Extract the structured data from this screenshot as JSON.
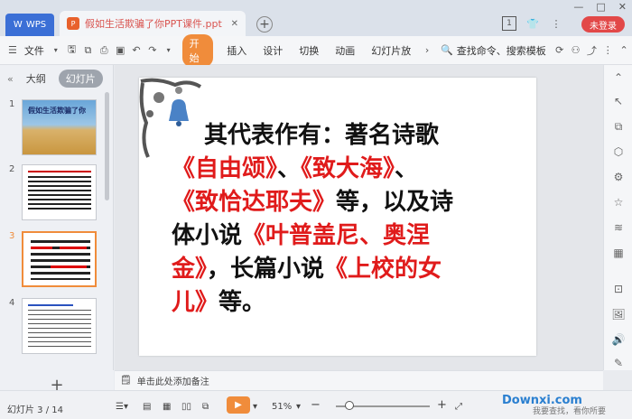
{
  "app": {
    "name": "WPS",
    "doc_title": "假如生活欺骗了你PPT课件.ppt",
    "login_label": "未登录"
  },
  "ribbon": {
    "file_label": "文件",
    "start_label": "开始",
    "tabs": [
      "插入",
      "设计",
      "切换",
      "动画",
      "幻灯片放"
    ],
    "search_label": "查找命令、搜索模板"
  },
  "panel": {
    "tab_outline": "大纲",
    "tab_slides": "幻灯片",
    "slide_numbers": [
      "1",
      "2",
      "3",
      "4"
    ],
    "thumb1_title": "假如生活欺骗了你"
  },
  "slide": {
    "line1": "其代表作有：著名诗歌",
    "line2a": "《自由颂》",
    "line2b": "、",
    "line2c": "《致大海》",
    "line2d": "、",
    "line3a": "《致恰达耶夫》",
    "line3b": "等，以及诗",
    "line4a": "体小说",
    "line4b": "《叶普盖尼、奥涅",
    "line5a": "金》",
    "line5b": "，长篇小说",
    "line5c": "《上校的女",
    "line6a": "儿》",
    "line6b": "等。"
  },
  "notes": {
    "placeholder": "单击此处添加备注"
  },
  "status": {
    "slide_pos": "幻灯片 3 / 14",
    "zoom": "51%"
  },
  "watermark": {
    "text": "Downxi.com",
    "sub": "我要查找，看你所要"
  }
}
